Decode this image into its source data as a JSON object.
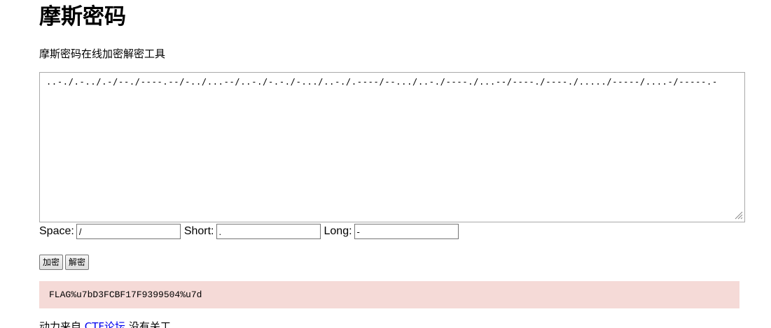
{
  "page": {
    "title": "摩斯密码",
    "subtitle": "摩斯密码在线加密解密工具"
  },
  "editor": {
    "value": "..-./.-../.-/--./----.--/-../...--/..-./-.-./-.../..-./.----/--.../..-./----./...--/----./----./...../-----/....-/-----.-"
  },
  "options": {
    "space_label": "Space:",
    "space_value": "/",
    "short_label": "Short:",
    "short_value": ".",
    "long_label": "Long:",
    "long_value": "-"
  },
  "buttons": {
    "encrypt_label": "加密",
    "decrypt_label": "解密"
  },
  "result": {
    "text": "FLAG%u7bD3FCBF17F9399504%u7d",
    "background": "#f5dad7"
  },
  "footer": {
    "prefix": "动力来自 ",
    "link_text": "CTF论坛",
    "suffix": " 没有关工"
  }
}
